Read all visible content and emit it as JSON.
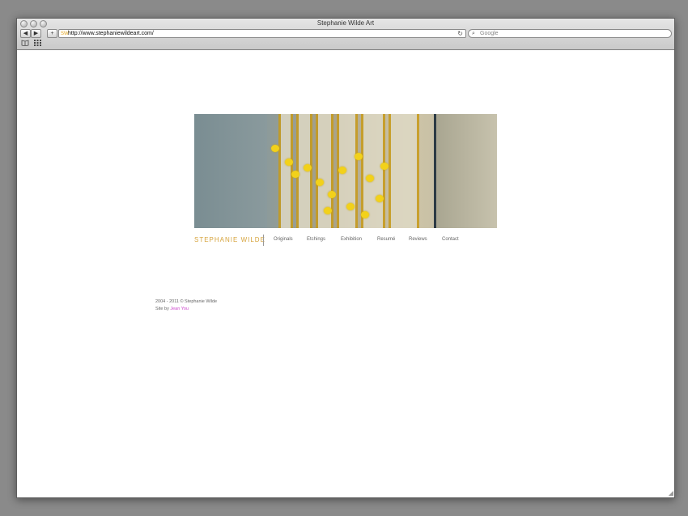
{
  "window": {
    "title": "Stephanie Wilde Art"
  },
  "toolbar": {
    "back_icon": "◀",
    "forward_icon": "▶",
    "add_bookmark_icon": "+",
    "favicon_text": "SW",
    "url": "http://www.stephaniewildeart.com/",
    "reload_icon": "↻",
    "search_icon": "⌕",
    "search_placeholder": "Google",
    "bookmarks_icon": "📖",
    "top_sites_icon": "▦"
  },
  "site": {
    "brand": "STEPHANIE WILDE",
    "nav": [
      "Originals",
      "Etchings",
      "Exhibition",
      "Resumé",
      "Reviews",
      "Contact"
    ],
    "footer": {
      "copyright": "2004 - 2011 © Stephanie Wilde",
      "credit_prefix": "Site by",
      "credit_name": "Jean You"
    }
  },
  "colors": {
    "brand": "#d6a33c",
    "link": "#cc44cc"
  }
}
